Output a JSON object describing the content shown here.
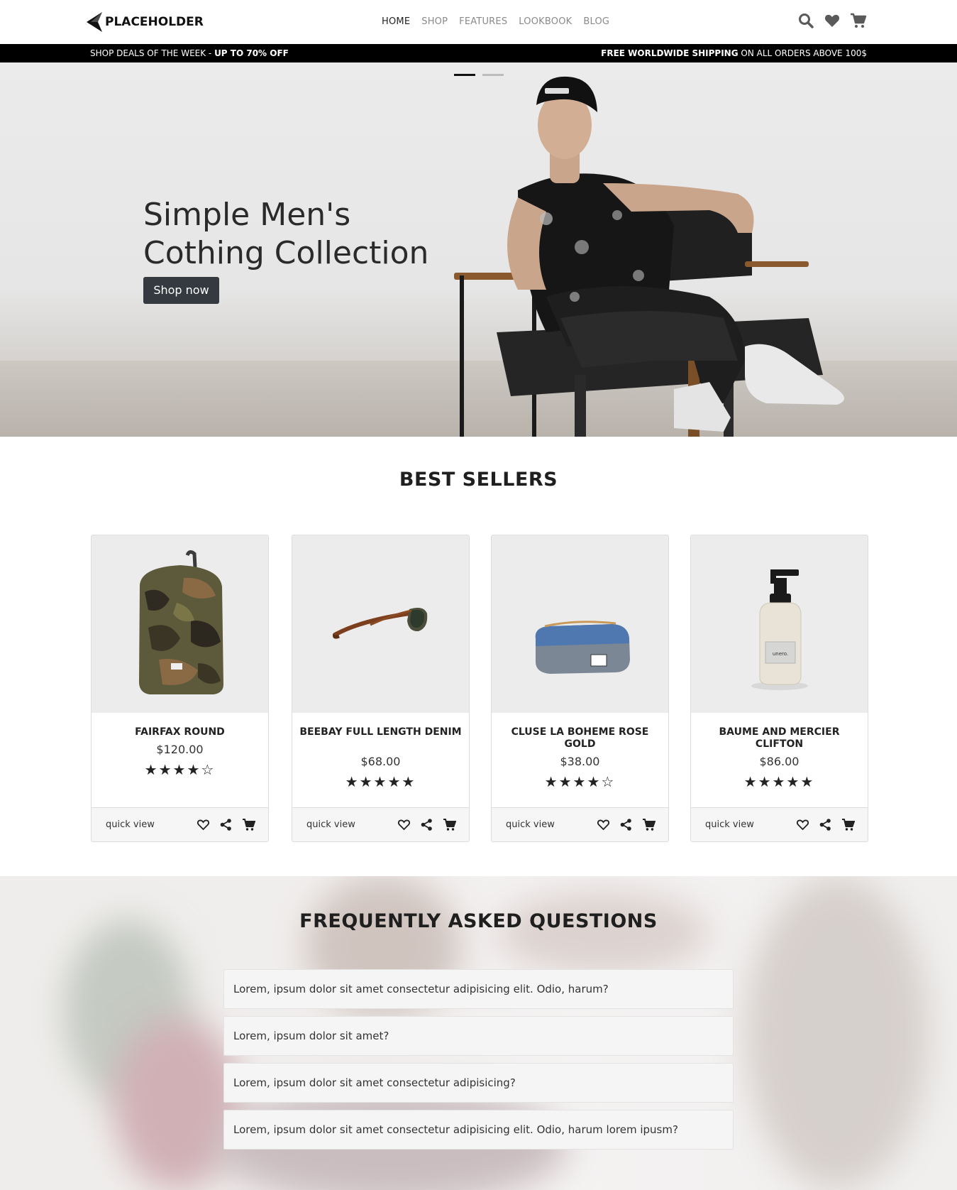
{
  "nav": {
    "logo_text": "PLACEHOLDER",
    "menu": [
      {
        "label": "HOME",
        "active": true
      },
      {
        "label": "SHOP",
        "active": false
      },
      {
        "label": "FEATURES",
        "active": false
      },
      {
        "label": "LOOKBOOK",
        "active": false
      },
      {
        "label": "BLOG",
        "active": false
      }
    ],
    "icons": [
      "search-icon",
      "heart-icon",
      "cart-icon"
    ]
  },
  "deals_bar": {
    "left_prefix": "SHOP DEALS OF THE WEEK - ",
    "left_bold": "UP TO 70% OFF",
    "right_bold": "FREE WORLDWIDE SHIPPING",
    "right_suffix": " ON ALL ORDERS ABOVE 100$"
  },
  "hero": {
    "title_line1": "Simple Men's",
    "title_line2": "Cothing Collection",
    "button_label": "Shop now",
    "slides": 2,
    "active_slide": 1
  },
  "best_sellers": {
    "title": "BEST SELLERS",
    "products": [
      {
        "name": "FAIRFAX ROUND",
        "price": "$120.00",
        "rating": 4,
        "image_icon": "camo-backpack-icon"
      },
      {
        "name": "BEEBAY FULL LENGTH DENIM",
        "price": "$68.00",
        "rating": 5,
        "image_icon": "sunglasses-icon"
      },
      {
        "name": "CLUSE LA BOHEME ROSE GOLD",
        "price": "$38.00",
        "rating": 4,
        "image_icon": "pencil-case-icon"
      },
      {
        "name": "BAUME AND MERCIER CLIFTON",
        "price": "$86.00",
        "rating": 5,
        "image_icon": "soap-dispenser-icon",
        "label": "unero."
      }
    ],
    "quick_view_label": "quick view"
  },
  "faq": {
    "title": "FREQUENTLY ASKED QUESTIONS",
    "questions": [
      "Lorem, ipsum dolor sit amet consectetur adipisicing elit. Odio, harum?",
      "Lorem, ipsum dolor sit amet?",
      "Lorem, ipsum dolor sit amet consectetur adipisicing?",
      "Lorem, ipsum dolor sit amet consectetur adipisicing elit. Odio, harum lorem ipusm?"
    ]
  },
  "colors": {
    "dark_button": "#343a40",
    "deals_bar_bg": "#000000",
    "card_image_bg": "#ececec",
    "card_footer_bg": "#f6f6f6"
  }
}
